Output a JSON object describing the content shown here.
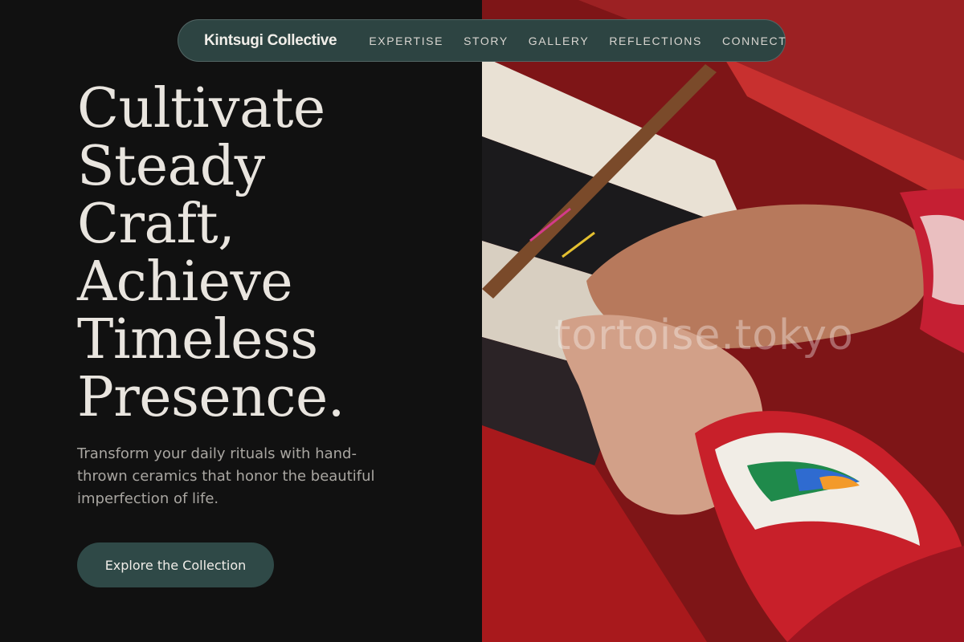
{
  "nav": {
    "brand": "Kintsugi Collective",
    "links": [
      {
        "label": "EXPERTISE"
      },
      {
        "label": "STORY"
      },
      {
        "label": "GALLERY"
      },
      {
        "label": "REFLECTIONS"
      },
      {
        "label": "CONNECT"
      }
    ]
  },
  "hero": {
    "headline_lines": [
      "Cultivate",
      "Steady",
      "Craft,",
      "Achieve",
      "Timeless",
      "Presence."
    ],
    "subtext": "Transform your daily rituals with hand-thrown ceramics that honor the beautiful imperfection of life.",
    "cta_label": "Explore the Collection"
  },
  "photo": {
    "watermark": "tortoise.tokyo"
  },
  "colors": {
    "background": "#111111",
    "accent": "#2f4947",
    "headline": "#e9e5df"
  }
}
